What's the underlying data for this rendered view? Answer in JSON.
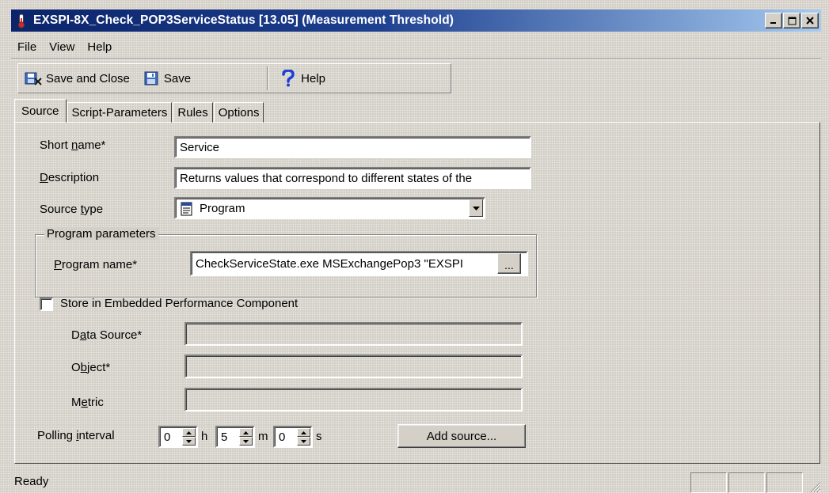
{
  "window": {
    "title": "EXSPI-8X_Check_POP3ServiceStatus [13.05] (Measurement Threshold)",
    "title_icon": "thermometer-icon",
    "controls": [
      "minimize",
      "maximize",
      "close"
    ]
  },
  "menu": [
    "File",
    "View",
    "Help"
  ],
  "toolbar": {
    "save_close_label": "Save and Close",
    "save_label": "Save",
    "help_label": "Help"
  },
  "tabs": [
    "Source",
    "Script-Parameters",
    "Rules",
    "Options"
  ],
  "active_tab": "Source",
  "form": {
    "short_name_label_a": "Short ",
    "short_name_label_u": "n",
    "short_name_label_b": "ame*",
    "short_name_value": "Service",
    "description_label_u": "D",
    "description_label_b": "escription",
    "description_value": "Returns values that correspond to different states of the",
    "source_type_label_a": "Source ",
    "source_type_label_u": "t",
    "source_type_label_b": "ype",
    "source_type_value": "Program",
    "program_group_title": "Program parameters",
    "program_name_label_a": "P",
    "program_name_label_b": "rogram name*",
    "program_name_value": "CheckServiceState.exe MSExchangePop3 \"EXSPI",
    "browse_label": "...",
    "store_checkbox_label": "Store in Embedded Performance Component",
    "store_checked": false,
    "data_source_label_a": "D",
    "data_source_label_u": "a",
    "data_source_label_b": "ta Source*",
    "object_label_a": "O",
    "object_label_u": "b",
    "object_label_b": "ject*",
    "metric_label_a": "M",
    "metric_label_u": "e",
    "metric_label_b": "tric",
    "polling_label_a": "Polling ",
    "polling_label_u": "i",
    "polling_label_b": "nterval",
    "hours_value": "0",
    "hours_unit": "h",
    "minutes_value": "5",
    "minutes_unit": "m",
    "seconds_value": "0",
    "seconds_unit": "s",
    "add_source_label": "Add source..."
  },
  "status": {
    "text": "Ready"
  }
}
